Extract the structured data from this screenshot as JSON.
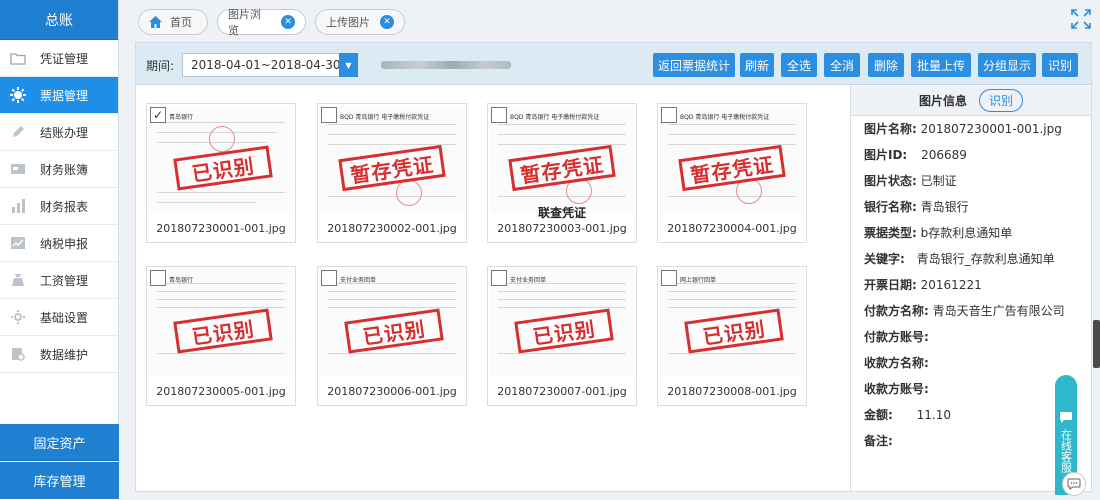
{
  "sidebar": {
    "title": "总账",
    "items": [
      {
        "label": "凭证管理",
        "icon": "folder-icon"
      },
      {
        "label": "票据管理",
        "icon": "gear-icon"
      },
      {
        "label": "结账办理",
        "icon": "pencil-icon"
      },
      {
        "label": "财务账簿",
        "icon": "card-icon"
      },
      {
        "label": "财务报表",
        "icon": "bar-chart-icon"
      },
      {
        "label": "纳税申报",
        "icon": "trend-chart-icon"
      },
      {
        "label": "工资管理",
        "icon": "money-bag-icon"
      },
      {
        "label": "基础设置",
        "icon": "cog-icon"
      },
      {
        "label": "数据维护",
        "icon": "database-icon"
      }
    ],
    "bottom": [
      "固定资产",
      "库存管理"
    ]
  },
  "tabs": [
    {
      "label": "首页",
      "icon": "home-icon"
    },
    {
      "label": "图片浏览",
      "close": "✕"
    },
    {
      "label": "上传图片",
      "close": "✕"
    }
  ],
  "toolbar": {
    "period_label": "期间:",
    "period_value": "2018-04-01~2018-04-30",
    "buttons": [
      "返回票据统计",
      "刷新",
      "全选",
      "全消",
      "删除",
      "批量上传",
      "分组显示",
      "识别"
    ]
  },
  "thumbnails": [
    {
      "filename": "201807230001-001.jpg",
      "stamp": "已识别",
      "checked": true,
      "header": "青岛银行"
    },
    {
      "filename": "201807230002-001.jpg",
      "stamp": "暂存凭证",
      "checked": false,
      "header": "BQD 青岛银行  电子缴税付款凭证"
    },
    {
      "filename": "201807230003-001.jpg",
      "stamp": "暂存凭证",
      "checked": false,
      "header": "BQD 青岛银行  电子缴税付款凭证",
      "overlay": "联查凭证"
    },
    {
      "filename": "201807230004-001.jpg",
      "stamp": "暂存凭证",
      "checked": false,
      "header": "BQD 青岛银行  电子缴税付款凭证"
    },
    {
      "filename": "201807230005-001.jpg",
      "stamp": "已识别",
      "checked": false,
      "header": "青岛银行"
    },
    {
      "filename": "201807230006-001.jpg",
      "stamp": "已识别",
      "checked": false,
      "header": "支付业务回单"
    },
    {
      "filename": "201807230007-001.jpg",
      "stamp": "已识别",
      "checked": false,
      "header": "支付业务回单"
    },
    {
      "filename": "201807230008-001.jpg",
      "stamp": "已识别",
      "checked": false,
      "header": "网上银行回单"
    }
  ],
  "info_panel": {
    "title": "图片信息",
    "identify_button": "识别",
    "fields": [
      {
        "label": "图片名称:",
        "value": "201807230001-001.jpg"
      },
      {
        "label": "图片ID:",
        "value": "206689"
      },
      {
        "label": "图片状态:",
        "value": "已制证"
      },
      {
        "label": "银行名称:",
        "value": "青岛银行"
      },
      {
        "label": "票据类型:",
        "value": "b存款利息通知单"
      },
      {
        "label": "关键字:",
        "value": "青岛银行_存款利息通知单"
      },
      {
        "label": "开票日期:",
        "value": "20161221"
      },
      {
        "label": "付款方名称:",
        "value": "青岛天音生广告有限公司"
      },
      {
        "label": "付款方账号:",
        "value": ""
      },
      {
        "label": "收款方名称:",
        "value": ""
      },
      {
        "label": "收款方账号:",
        "value": ""
      },
      {
        "label": "金额:",
        "value": "11.10"
      },
      {
        "label": "备注:",
        "value": ""
      }
    ]
  },
  "service": {
    "label": "在线客服"
  },
  "colors": {
    "primary": "#2b8ee0",
    "sidebar_header": "#1f7fd0",
    "stamp_red": "#d72f2f",
    "toolbar_bg": "#dceaf4"
  }
}
